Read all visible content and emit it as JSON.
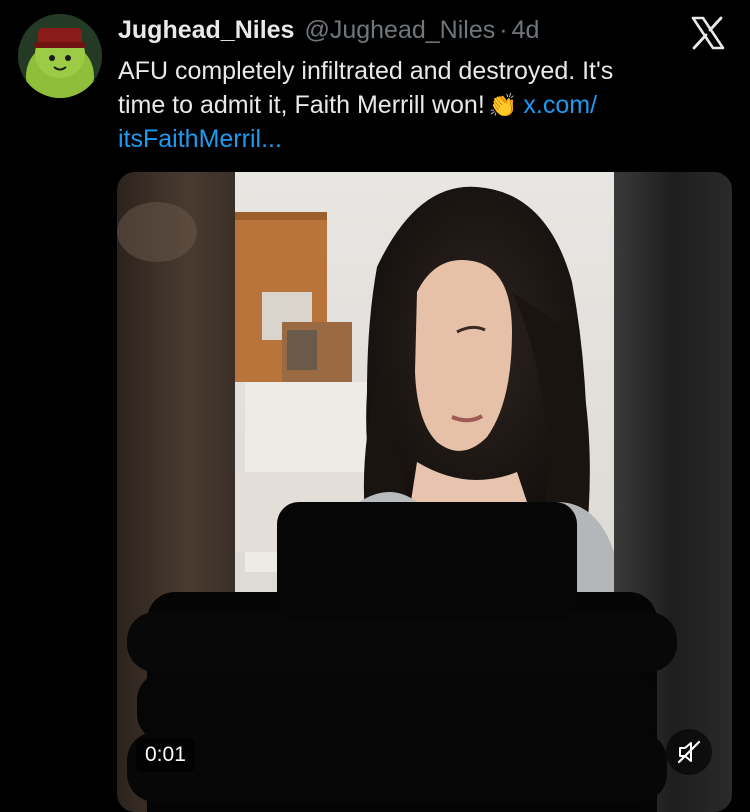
{
  "tweet": {
    "display_name": "Jughead_Niles",
    "handle": "@Jughead_Niles",
    "separator": "·",
    "timestamp": "4d",
    "text_line1": "AFU completely infiltrated and destroyed. It's",
    "text_line2": "time to admit it, Faith Merrill won!",
    "emoji": "👏",
    "link_part1": "x.com/",
    "link_part2": "itsFaithMerril..."
  },
  "video": {
    "time": "0:01",
    "muted_icon": "speaker-muted-icon"
  },
  "brand": {
    "logo": "x-logo-icon",
    "accent_color": "#1d9bf0",
    "text_color": "#e7e9ea",
    "secondary_color": "#71767b"
  }
}
